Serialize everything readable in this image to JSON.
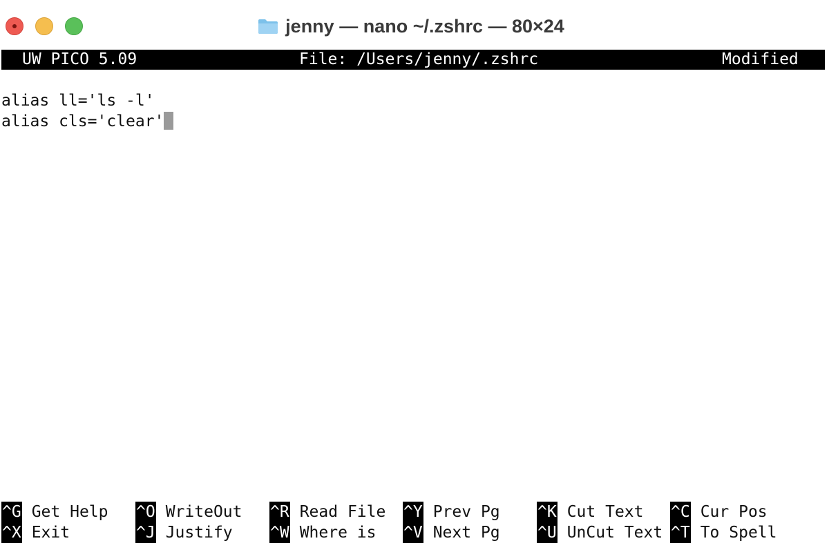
{
  "window": {
    "title": "jenny — nano ~/.zshrc — 80×24",
    "folder_icon": "folder-icon",
    "colors": {
      "close": "#ee5a52",
      "minimize": "#f5be4f",
      "maximize": "#5ac05a",
      "header_bg": "#000000",
      "cursor": "#9a9a9a"
    }
  },
  "header": {
    "app": "UW PICO 5.09",
    "file": "File: /Users/jenny/.zshrc",
    "status": "Modified"
  },
  "editor": {
    "lines": [
      "alias ll='ls -l'",
      "alias cls='clear'"
    ]
  },
  "shortcuts": {
    "row1": [
      {
        "key": "^G",
        "label": "Get Help"
      },
      {
        "key": "^O",
        "label": "WriteOut"
      },
      {
        "key": "^R",
        "label": "Read File"
      },
      {
        "key": "^Y",
        "label": "Prev Pg"
      },
      {
        "key": "^K",
        "label": "Cut Text"
      },
      {
        "key": "^C",
        "label": "Cur Pos"
      }
    ],
    "row2": [
      {
        "key": "^X",
        "label": "Exit"
      },
      {
        "key": "^J",
        "label": "Justify"
      },
      {
        "key": "^W",
        "label": "Where is"
      },
      {
        "key": "^V",
        "label": "Next Pg"
      },
      {
        "key": "^U",
        "label": "UnCut Text"
      },
      {
        "key": "^T",
        "label": "To Spell"
      }
    ]
  }
}
